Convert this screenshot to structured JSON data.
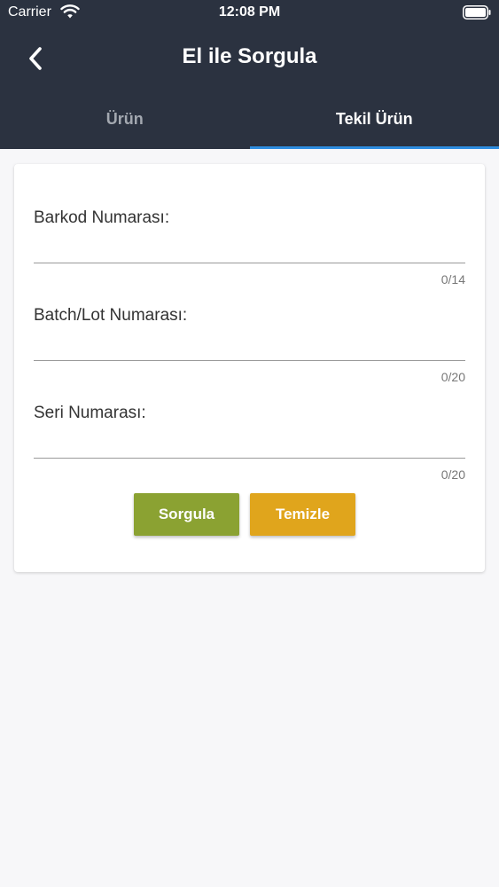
{
  "status_bar": {
    "carrier": "Carrier",
    "time": "12:08 PM",
    "icons": [
      "wifi-icon",
      "battery-icon"
    ]
  },
  "nav": {
    "title": "El ile Sorgula",
    "back_icon": "chevron-left-icon"
  },
  "tabs": [
    {
      "label": "Ürün",
      "active": false
    },
    {
      "label": "Tekil Ürün",
      "active": true
    }
  ],
  "form": {
    "fields": [
      {
        "label": "Barkod Numarası:",
        "value": "",
        "counter": "0/14"
      },
      {
        "label": "Batch/Lot Numarası:",
        "value": "",
        "counter": "0/20"
      },
      {
        "label": "Seri Numarası:",
        "value": "",
        "counter": "0/20"
      }
    ],
    "query_button": "Sorgula",
    "clear_button": "Temizle"
  },
  "colors": {
    "header_bg": "#2b3240",
    "tab_indicator": "#2e8de0",
    "query_button": "#8ba232",
    "clear_button": "#e0a51c",
    "page_bg": "#f7f7f9"
  }
}
